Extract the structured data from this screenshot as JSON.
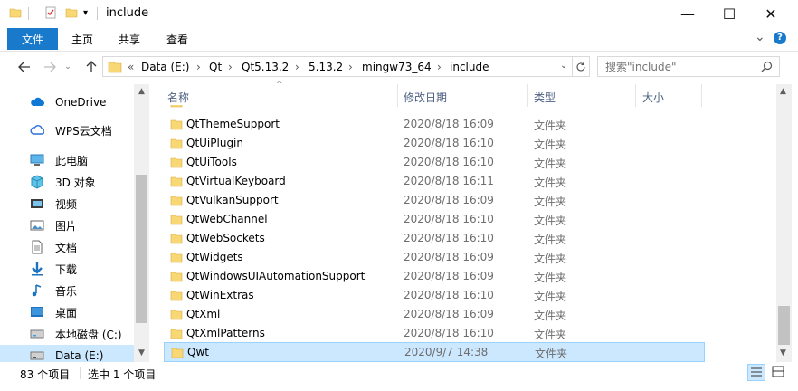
{
  "window": {
    "title": "include",
    "minimize_glyph": "—",
    "maximize_glyph": "☐",
    "close_glyph": "✕"
  },
  "ribbon": {
    "tabs": [
      {
        "label": "文件",
        "active": true
      },
      {
        "label": "主页"
      },
      {
        "label": "共享"
      },
      {
        "label": "查看"
      }
    ],
    "expand_glyph": "⌄",
    "help_glyph": "?"
  },
  "address": {
    "prefix": "«",
    "crumbs": [
      "Data (E:)",
      "Qt",
      "Qt5.13.2",
      "5.13.2",
      "mingw73_64",
      "include"
    ],
    "separator": "›"
  },
  "search": {
    "placeholder": "搜索\"include\""
  },
  "nav": {
    "items": [
      {
        "label": "OneDrive",
        "icon": "cloud-icon"
      },
      {
        "label": "WPS云文档",
        "icon": "cloud-doc-icon"
      },
      {
        "label": "此电脑",
        "icon": "computer-icon"
      },
      {
        "label": "3D 对象",
        "icon": "cube-3d-icon"
      },
      {
        "label": "视频",
        "icon": "video-icon"
      },
      {
        "label": "图片",
        "icon": "picture-icon"
      },
      {
        "label": "文档",
        "icon": "document-icon"
      },
      {
        "label": "下载",
        "icon": "download-icon"
      },
      {
        "label": "音乐",
        "icon": "music-icon"
      },
      {
        "label": "桌面",
        "icon": "desktop-icon"
      },
      {
        "label": "本地磁盘 (C:)",
        "icon": "drive-icon"
      },
      {
        "label": "Data (E:)",
        "icon": "drive-icon",
        "selected": true
      }
    ]
  },
  "columns": {
    "name": "名称",
    "date": "修改日期",
    "type": "类型",
    "size": "大小"
  },
  "files": [
    {
      "name": "QtThemeSupport",
      "date": "2020/8/18 16:09",
      "type": "文件夹"
    },
    {
      "name": "QtUiPlugin",
      "date": "2020/8/18 16:10",
      "type": "文件夹"
    },
    {
      "name": "QtUiTools",
      "date": "2020/8/18 16:10",
      "type": "文件夹"
    },
    {
      "name": "QtVirtualKeyboard",
      "date": "2020/8/18 16:11",
      "type": "文件夹"
    },
    {
      "name": "QtVulkanSupport",
      "date": "2020/8/18 16:09",
      "type": "文件夹"
    },
    {
      "name": "QtWebChannel",
      "date": "2020/8/18 16:10",
      "type": "文件夹"
    },
    {
      "name": "QtWebSockets",
      "date": "2020/8/18 16:10",
      "type": "文件夹"
    },
    {
      "name": "QtWidgets",
      "date": "2020/8/18 16:09",
      "type": "文件夹"
    },
    {
      "name": "QtWindowsUIAutomationSupport",
      "date": "2020/8/18 16:09",
      "type": "文件夹"
    },
    {
      "name": "QtWinExtras",
      "date": "2020/8/18 16:10",
      "type": "文件夹"
    },
    {
      "name": "QtXml",
      "date": "2020/8/18 16:09",
      "type": "文件夹"
    },
    {
      "name": "QtXmlPatterns",
      "date": "2020/8/18 16:10",
      "type": "文件夹"
    },
    {
      "name": "Qwt",
      "date": "2020/9/7 14:38",
      "type": "文件夹",
      "selected": true
    }
  ],
  "status": {
    "count": "83 个项目",
    "selected": "选中 1 个项目"
  },
  "colors": {
    "accent": "#1979ca",
    "selection": "#cce8ff",
    "selection_border": "#99d1ff",
    "folder": "#f8d775"
  }
}
